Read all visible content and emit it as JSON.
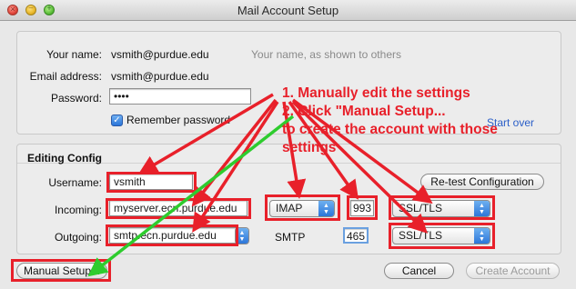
{
  "window": {
    "title": "Mail Account Setup",
    "controls": {
      "close": "×",
      "minimize": "–",
      "maximize": "+"
    }
  },
  "account": {
    "your_name_label": "Your name:",
    "your_name_value": "vsmith@purdue.edu",
    "your_name_hint": "Your name, as shown to others",
    "email_label": "Email address:",
    "email_value": "vsmith@purdue.edu",
    "password_label": "Password:",
    "password_value": "••••",
    "remember_label": "Remember password",
    "remember_checked": true,
    "start_over": "Start over"
  },
  "config": {
    "heading": "Editing Config",
    "username_label": "Username:",
    "username_value": "vsmith",
    "retest_label": "Re-test Configuration",
    "incoming_label": "Incoming:",
    "incoming_server": "myserver.ecn.purdue.edu",
    "incoming_protocol": "IMAP",
    "incoming_port": "993",
    "incoming_ssl": "SSL/TLS",
    "outgoing_label": "Outgoing:",
    "outgoing_server": "smtp.ecn.purdue.edu",
    "outgoing_protocol": "SMTP",
    "outgoing_port": "465",
    "outgoing_ssl": "SSL/TLS"
  },
  "footer": {
    "manual_setup": "Manual Setup...",
    "cancel": "Cancel",
    "create_account": "Create Account"
  },
  "annotations": {
    "step1": "1. Manually edit the settings",
    "step2": "2. Click \"Manual Setup...",
    "step2b": "to create the account with those",
    "step2c": "settings",
    "color_red": "#e8202a",
    "color_green": "#2ecc2e"
  }
}
